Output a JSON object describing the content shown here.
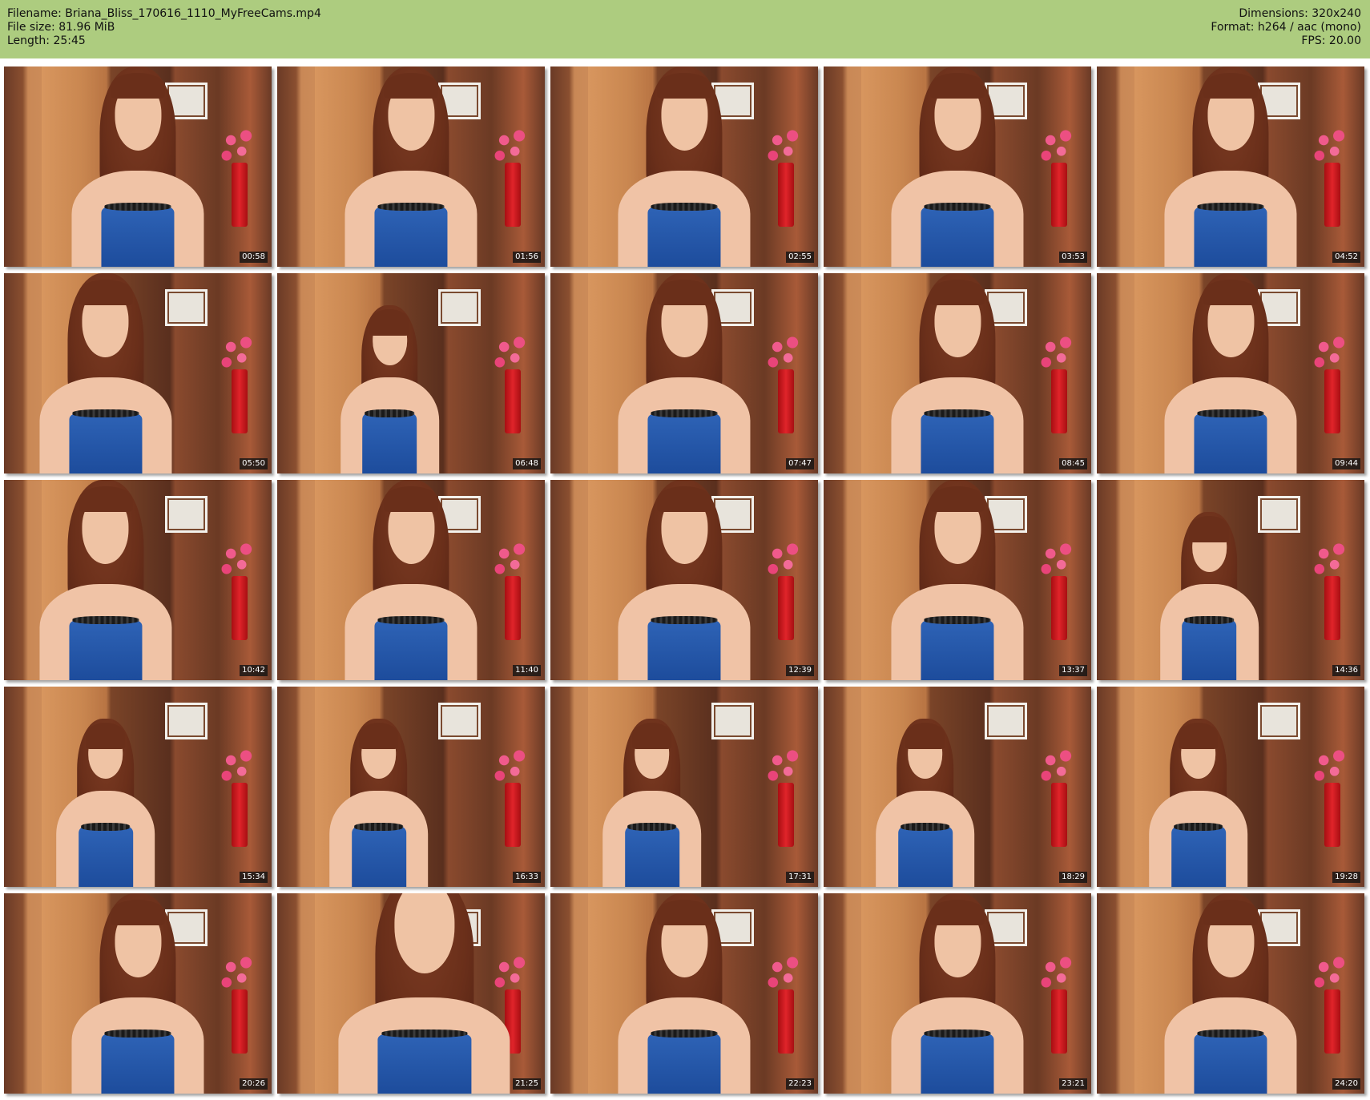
{
  "header": {
    "filename": "Filename: Briana_Bliss_170616_1110_MyFreeCams.mp4",
    "file_size": "File size: 81.96 MiB",
    "length": "Length: 25:45",
    "dimensions": "Dimensions: 320x240",
    "format": "Format: h264 / aac (mono)",
    "fps": "FPS: 20.00"
  },
  "colors": {
    "header_bg": "#adcc7f",
    "timestamp_bg": "#141414",
    "timestamp_text": "#ffffff"
  },
  "thumbnails": [
    {
      "time": "00:58"
    },
    {
      "time": "01:56"
    },
    {
      "time": "02:55"
    },
    {
      "time": "03:53"
    },
    {
      "time": "04:52"
    },
    {
      "time": "05:50"
    },
    {
      "time": "06:48"
    },
    {
      "time": "07:47"
    },
    {
      "time": "08:45"
    },
    {
      "time": "09:44"
    },
    {
      "time": "10:42"
    },
    {
      "time": "11:40"
    },
    {
      "time": "12:39"
    },
    {
      "time": "13:37"
    },
    {
      "time": "14:36"
    },
    {
      "time": "15:34"
    },
    {
      "time": "16:33"
    },
    {
      "time": "17:31"
    },
    {
      "time": "18:29"
    },
    {
      "time": "19:28"
    },
    {
      "time": "20:26"
    },
    {
      "time": "21:25"
    },
    {
      "time": "22:23"
    },
    {
      "time": "23:21"
    },
    {
      "time": "24:20"
    }
  ]
}
